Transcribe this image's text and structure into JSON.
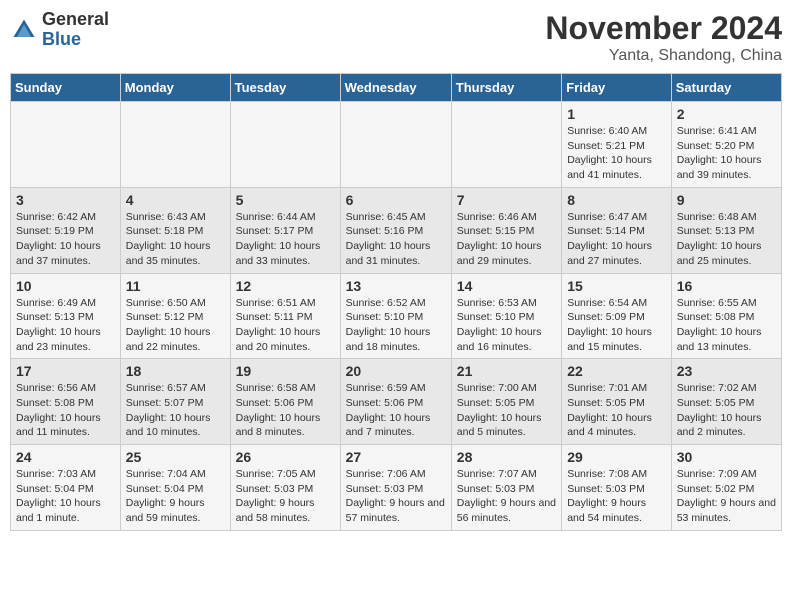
{
  "logo": {
    "general": "General",
    "blue": "Blue"
  },
  "header": {
    "month": "November 2024",
    "location": "Yanta, Shandong, China"
  },
  "days_of_week": [
    "Sunday",
    "Monday",
    "Tuesday",
    "Wednesday",
    "Thursday",
    "Friday",
    "Saturday"
  ],
  "weeks": [
    [
      {
        "day": "",
        "info": ""
      },
      {
        "day": "",
        "info": ""
      },
      {
        "day": "",
        "info": ""
      },
      {
        "day": "",
        "info": ""
      },
      {
        "day": "",
        "info": ""
      },
      {
        "day": "1",
        "info": "Sunrise: 6:40 AM\nSunset: 5:21 PM\nDaylight: 10 hours and 41 minutes."
      },
      {
        "day": "2",
        "info": "Sunrise: 6:41 AM\nSunset: 5:20 PM\nDaylight: 10 hours and 39 minutes."
      }
    ],
    [
      {
        "day": "3",
        "info": "Sunrise: 6:42 AM\nSunset: 5:19 PM\nDaylight: 10 hours and 37 minutes."
      },
      {
        "day": "4",
        "info": "Sunrise: 6:43 AM\nSunset: 5:18 PM\nDaylight: 10 hours and 35 minutes."
      },
      {
        "day": "5",
        "info": "Sunrise: 6:44 AM\nSunset: 5:17 PM\nDaylight: 10 hours and 33 minutes."
      },
      {
        "day": "6",
        "info": "Sunrise: 6:45 AM\nSunset: 5:16 PM\nDaylight: 10 hours and 31 minutes."
      },
      {
        "day": "7",
        "info": "Sunrise: 6:46 AM\nSunset: 5:15 PM\nDaylight: 10 hours and 29 minutes."
      },
      {
        "day": "8",
        "info": "Sunrise: 6:47 AM\nSunset: 5:14 PM\nDaylight: 10 hours and 27 minutes."
      },
      {
        "day": "9",
        "info": "Sunrise: 6:48 AM\nSunset: 5:13 PM\nDaylight: 10 hours and 25 minutes."
      }
    ],
    [
      {
        "day": "10",
        "info": "Sunrise: 6:49 AM\nSunset: 5:13 PM\nDaylight: 10 hours and 23 minutes."
      },
      {
        "day": "11",
        "info": "Sunrise: 6:50 AM\nSunset: 5:12 PM\nDaylight: 10 hours and 22 minutes."
      },
      {
        "day": "12",
        "info": "Sunrise: 6:51 AM\nSunset: 5:11 PM\nDaylight: 10 hours and 20 minutes."
      },
      {
        "day": "13",
        "info": "Sunrise: 6:52 AM\nSunset: 5:10 PM\nDaylight: 10 hours and 18 minutes."
      },
      {
        "day": "14",
        "info": "Sunrise: 6:53 AM\nSunset: 5:10 PM\nDaylight: 10 hours and 16 minutes."
      },
      {
        "day": "15",
        "info": "Sunrise: 6:54 AM\nSunset: 5:09 PM\nDaylight: 10 hours and 15 minutes."
      },
      {
        "day": "16",
        "info": "Sunrise: 6:55 AM\nSunset: 5:08 PM\nDaylight: 10 hours and 13 minutes."
      }
    ],
    [
      {
        "day": "17",
        "info": "Sunrise: 6:56 AM\nSunset: 5:08 PM\nDaylight: 10 hours and 11 minutes."
      },
      {
        "day": "18",
        "info": "Sunrise: 6:57 AM\nSunset: 5:07 PM\nDaylight: 10 hours and 10 minutes."
      },
      {
        "day": "19",
        "info": "Sunrise: 6:58 AM\nSunset: 5:06 PM\nDaylight: 10 hours and 8 minutes."
      },
      {
        "day": "20",
        "info": "Sunrise: 6:59 AM\nSunset: 5:06 PM\nDaylight: 10 hours and 7 minutes."
      },
      {
        "day": "21",
        "info": "Sunrise: 7:00 AM\nSunset: 5:05 PM\nDaylight: 10 hours and 5 minutes."
      },
      {
        "day": "22",
        "info": "Sunrise: 7:01 AM\nSunset: 5:05 PM\nDaylight: 10 hours and 4 minutes."
      },
      {
        "day": "23",
        "info": "Sunrise: 7:02 AM\nSunset: 5:05 PM\nDaylight: 10 hours and 2 minutes."
      }
    ],
    [
      {
        "day": "24",
        "info": "Sunrise: 7:03 AM\nSunset: 5:04 PM\nDaylight: 10 hours and 1 minute."
      },
      {
        "day": "25",
        "info": "Sunrise: 7:04 AM\nSunset: 5:04 PM\nDaylight: 9 hours and 59 minutes."
      },
      {
        "day": "26",
        "info": "Sunrise: 7:05 AM\nSunset: 5:03 PM\nDaylight: 9 hours and 58 minutes."
      },
      {
        "day": "27",
        "info": "Sunrise: 7:06 AM\nSunset: 5:03 PM\nDaylight: 9 hours and 57 minutes."
      },
      {
        "day": "28",
        "info": "Sunrise: 7:07 AM\nSunset: 5:03 PM\nDaylight: 9 hours and 56 minutes."
      },
      {
        "day": "29",
        "info": "Sunrise: 7:08 AM\nSunset: 5:03 PM\nDaylight: 9 hours and 54 minutes."
      },
      {
        "day": "30",
        "info": "Sunrise: 7:09 AM\nSunset: 5:02 PM\nDaylight: 9 hours and 53 minutes."
      }
    ]
  ]
}
